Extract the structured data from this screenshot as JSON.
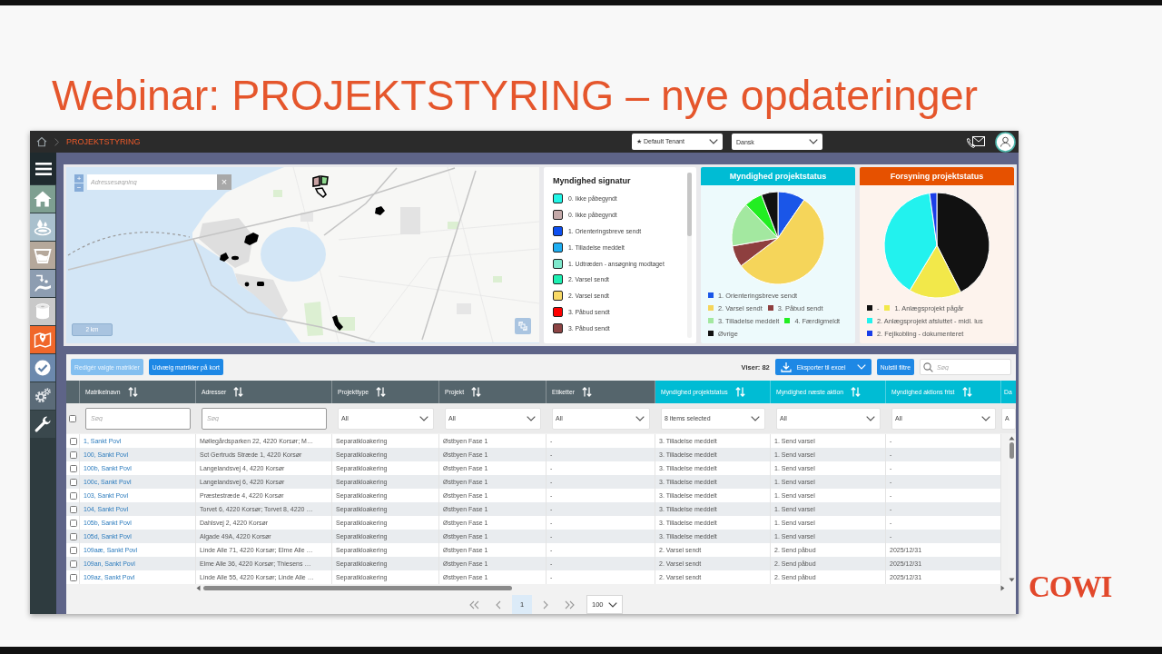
{
  "slide": {
    "title": "Webinar: PROJEKTSTYRING – nye opdateringer",
    "logo": "COWI"
  },
  "topbar": {
    "breadcrumb": "PROJEKTSTYRING",
    "tenant": "★ Default Tenant",
    "language": "Dansk"
  },
  "map": {
    "zoom_in": "+",
    "zoom_out": "−",
    "search": {
      "placeholder": "Adressesøgning"
    },
    "clear": "×",
    "scale": "2 km"
  },
  "legend": {
    "title": "Myndighed signatur",
    "items": [
      {
        "label": "0. Ikke påbegyndt",
        "color": "#22f5e6"
      },
      {
        "label": "0. Ikke påbegyndt",
        "color": "#c4a9a9"
      },
      {
        "label": "1. Orienteringsbreve sendt",
        "color": "#0d4ff0"
      },
      {
        "label": "1. Tilladelse meddelt",
        "color": "#1eaef2"
      },
      {
        "label": "1. Udtræden - ansøgning modtaget",
        "color": "#7ee8cc"
      },
      {
        "label": "2. Varsel sendt",
        "color": "#1ef0b2"
      },
      {
        "label": "2. Varsel sendt",
        "color": "#f8d966"
      },
      {
        "label": "3. Påbud sendt",
        "color": "#ff0000"
      },
      {
        "label": "3. Påbud sendt",
        "color": "#8c4444"
      }
    ]
  },
  "status_panels": [
    {
      "title": "Myndighed projektstatus",
      "color": "#00bcd4",
      "legend": [
        {
          "label": "1. Orienteringsbreve sendt",
          "color": "#1a56e8"
        },
        {
          "label": "2. Varsel sendt",
          "color": "#f5d55a"
        },
        {
          "label": "3. Påbud sendt",
          "color": "#8e3f3f"
        },
        {
          "label": "3. Tilladelse meddelt",
          "color": "#a3e8a0"
        },
        {
          "label": "4. Færdigmeldt",
          "color": "#22ee22"
        },
        {
          "label": "Øvrige",
          "color": "#111111"
        }
      ]
    },
    {
      "title": "Forsyning projektstatus",
      "color": "#e65100",
      "legend": [
        {
          "label": "-",
          "color": "#111111"
        },
        {
          "label": "1. Anlægsprojekt pågår",
          "color": "#f2e84a"
        },
        {
          "label": "2. Anlægsprojekt afsluttet - midl. lus",
          "color": "#22f2ee"
        },
        {
          "label": "2. Fejlkobling - dokumenteret",
          "color": "#1a3ee8"
        }
      ]
    }
  ],
  "table": {
    "buttons": [
      {
        "label": "Redigér valgte matrikler",
        "disabled": true
      },
      {
        "label": "Udvælg matrikler på kort",
        "disabled": false
      }
    ],
    "count": "Viser: 82",
    "export": "Eksporter til excel",
    "reset": "Nulstil filtre",
    "search": {
      "placeholder": "Søg"
    },
    "select_all": {
      "checked": false
    },
    "columns": [
      {
        "label": "Matrikelnavn",
        "color": "#55656c",
        "kind": "link",
        "filter": {
          "kind": "text",
          "placeholder": "Søg"
        }
      },
      {
        "label": "Adresser",
        "color": "#55656c",
        "kind": "text",
        "filter": {
          "kind": "text",
          "placeholder": "Søg"
        }
      },
      {
        "label": "Projekttype",
        "color": "#55656c",
        "kind": "text",
        "filter": {
          "kind": "select",
          "value": "All"
        }
      },
      {
        "label": "Projekt",
        "color": "#55656c",
        "kind": "text",
        "filter": {
          "kind": "select",
          "value": "All"
        }
      },
      {
        "label": "Etiketter",
        "color": "#55656c",
        "kind": "text",
        "filter": {
          "kind": "select",
          "value": "All"
        }
      },
      {
        "label": "Myndighed projektstatus",
        "color": "#00bcd4",
        "kind": "text",
        "filter": {
          "kind": "select",
          "value": "8 items selected"
        }
      },
      {
        "label": "Myndighed næste aktion",
        "color": "#00bcd4",
        "kind": "text",
        "filter": {
          "kind": "select",
          "value": "All"
        }
      },
      {
        "label": "Myndighed aktions frist",
        "color": "#00bcd4",
        "kind": "text",
        "filter": {
          "kind": "select",
          "value": "All"
        }
      },
      {
        "label": "Da",
        "color": "#00bcd4",
        "kind": "cut",
        "filter": {
          "kind": "select",
          "value": "A"
        }
      }
    ],
    "rows": [
      {
        "checked": false,
        "cells": [
          "1, Sankt Povl",
          "Møllegårdsparken 22, 4220 Korsør; M…",
          "Separatkloakering",
          "Østbyen Fase 1",
          "-",
          "3. Tilladelse meddelt",
          "1. Send varsel",
          "-"
        ]
      },
      {
        "checked": false,
        "cells": [
          "100, Sankt Povl",
          "Sct Gertruds Stræde 1, 4220 Korsør",
          "Separatkloakering",
          "Østbyen Fase 1",
          "-",
          "3. Tilladelse meddelt",
          "1. Send varsel",
          "-"
        ]
      },
      {
        "checked": false,
        "cells": [
          "100b, Sankt Povl",
          "Langelandsvej 4, 4220 Korsør",
          "Separatkloakering",
          "Østbyen Fase 1",
          "-",
          "3. Tilladelse meddelt",
          "1. Send varsel",
          "-"
        ]
      },
      {
        "checked": false,
        "cells": [
          "100c, Sankt Povl",
          "Langelandsvej 6, 4220 Korsør",
          "Separatkloakering",
          "Østbyen Fase 1",
          "-",
          "3. Tilladelse meddelt",
          "1. Send varsel",
          "-"
        ]
      },
      {
        "checked": false,
        "cells": [
          "103, Sankt Povl",
          "Præstestræde 4, 4220 Korsør",
          "Separatkloakering",
          "Østbyen Fase 1",
          "-",
          "3. Tilladelse meddelt",
          "1. Send varsel",
          "-"
        ]
      },
      {
        "checked": false,
        "cells": [
          "104, Sankt Povl",
          "Torvet 6, 4220 Korsør; Torvet 8, 4220 …",
          "Separatkloakering",
          "Østbyen Fase 1",
          "-",
          "3. Tilladelse meddelt",
          "1. Send varsel",
          "-"
        ]
      },
      {
        "checked": false,
        "cells": [
          "105b, Sankt Povl",
          "Dahlsvej 2, 4220 Korsør",
          "Separatkloakering",
          "Østbyen Fase 1",
          "-",
          "3. Tilladelse meddelt",
          "1. Send varsel",
          "-"
        ]
      },
      {
        "checked": false,
        "cells": [
          "105d, Sankt Povl",
          "Algade 49A, 4220 Korsør",
          "Separatkloakering",
          "Østbyen Fase 1",
          "-",
          "3. Tilladelse meddelt",
          "1. Send varsel",
          "-"
        ]
      },
      {
        "checked": false,
        "cells": [
          "109aæ, Sankt Povl",
          "Linde Alle 71, 4220 Korsør; Elme Alle …",
          "Separatkloakering",
          "Østbyen Fase 1",
          "-",
          "2. Varsel sendt",
          "2. Send påbud",
          "2025/12/31"
        ]
      },
      {
        "checked": false,
        "cells": [
          "109an, Sankt Povl",
          "Elme Alle 36, 4220 Korsør; Thiesens …",
          "Separatkloakering",
          "Østbyen Fase 1",
          "-",
          "2. Varsel sendt",
          "2. Send påbud",
          "2025/12/31"
        ]
      },
      {
        "checked": false,
        "cells": [
          "109az, Sankt Povl",
          "Linde Alle 55, 4220 Korsør; Linde Alle …",
          "Separatkloakering",
          "Østbyen Fase 1",
          "-",
          "2. Varsel sendt",
          "2. Send påbud",
          "2025/12/31"
        ]
      }
    ],
    "pagination": {
      "pages": [
        {
          "label": "1",
          "selected": true
        }
      ],
      "page_size": "100"
    }
  }
}
